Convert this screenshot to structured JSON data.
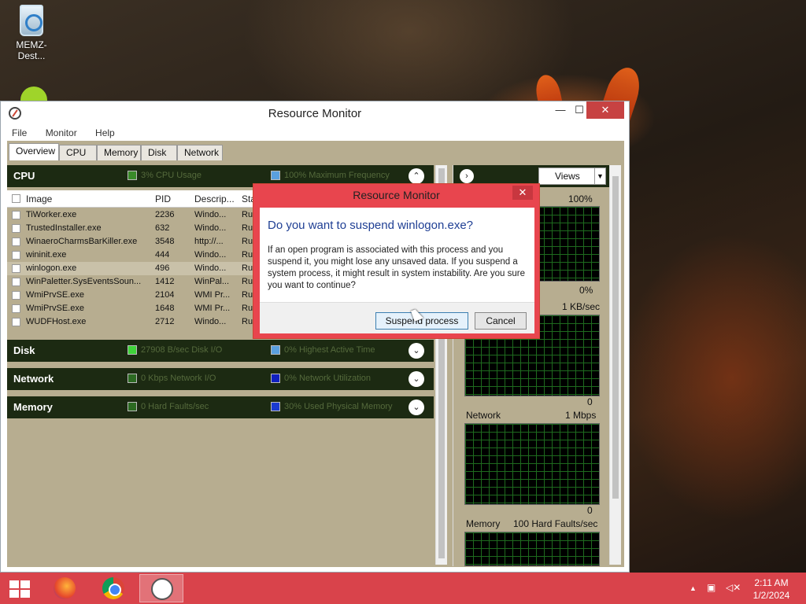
{
  "desktop": {
    "icon_label": "MEMZ-Dest..."
  },
  "window": {
    "title": "Resource Monitor",
    "controls": {
      "minimize": "—",
      "maximize": "☐",
      "close": "✕"
    },
    "menu": [
      "File",
      "Monitor",
      "Help"
    ],
    "tabs": [
      "Overview",
      "CPU",
      "Memory",
      "Disk",
      "Network"
    ]
  },
  "cpu_section": {
    "title": "CPU",
    "indicator1": "3% CPU Usage",
    "indicator2": "100% Maximum Frequency",
    "chevron": "⌃",
    "columns": {
      "image": "Image",
      "pid": "PID",
      "desc": "Descrip...",
      "status": "Sta"
    },
    "rows": [
      {
        "image": "TiWorker.exe",
        "pid": "2236",
        "desc": "Windo...",
        "status": "Ru"
      },
      {
        "image": "TrustedInstaller.exe",
        "pid": "632",
        "desc": "Windo...",
        "status": "Ru"
      },
      {
        "image": "WinaeroCharmsBarKiller.exe",
        "pid": "3548",
        "desc": "http://...",
        "status": "Ru"
      },
      {
        "image": "wininit.exe",
        "pid": "444",
        "desc": "Windo...",
        "status": "Ru"
      },
      {
        "image": "winlogon.exe",
        "pid": "496",
        "desc": "Windo...",
        "status": "Ru"
      },
      {
        "image": "WinPaletter.SysEventsSoun...",
        "pid": "1412",
        "desc": "WinPal...",
        "status": "Ru"
      },
      {
        "image": "WmiPrvSE.exe",
        "pid": "2104",
        "desc": "WMI Pr...",
        "status": "Ru"
      },
      {
        "image": "WmiPrvSE.exe",
        "pid": "1648",
        "desc": "WMI Pr...",
        "status": "Ru"
      },
      {
        "image": "WUDFHost.exe",
        "pid": "2712",
        "desc": "Windo...",
        "status": "Ru"
      }
    ]
  },
  "disk_section": {
    "title": "Disk",
    "indicator1": "27908 B/sec Disk I/O",
    "indicator2": "0% Highest Active Time",
    "chevron": "⌄"
  },
  "network_section": {
    "title": "Network",
    "indicator1": "0 Kbps Network I/O",
    "indicator2": "0% Network Utilization",
    "chevron": "⌄"
  },
  "memory_section": {
    "title": "Memory",
    "indicator1": "0 Hard Faults/sec",
    "indicator2": "30% Used Physical Memory",
    "chevron": "⌄"
  },
  "right_pane": {
    "nav": "›",
    "views": "Views",
    "views_arrow": "▼",
    "cpu_graph": {
      "top": "100%",
      "bottom": "0%"
    },
    "disk_graph": {
      "top": "1 KB/sec",
      "bottom": "0"
    },
    "network_graph": {
      "label": "Network",
      "top": "1 Mbps",
      "bottom": "0"
    },
    "memory_graph": {
      "label": "Memory",
      "top": "100 Hard Faults/sec"
    }
  },
  "dialog": {
    "title": "Resource Monitor",
    "close": "✕",
    "question": "Do you want to suspend winlogon.exe?",
    "message": "If an open program is associated with this process and you suspend it, you might lose any unsaved data. If you suspend a system process, it might result in system instability. Are you sure you want to continue?",
    "primary": "Suspend process",
    "cancel": "Cancel"
  },
  "taskbar": {
    "tray_chevron": "▲",
    "time": "2:11 AM",
    "date": "1/2/2024"
  },
  "colors": {
    "taskbar": "#d9434b",
    "section_bar": "#1c2a12",
    "graph_grid": "#1e6a1e",
    "link": "#1f3f94"
  }
}
